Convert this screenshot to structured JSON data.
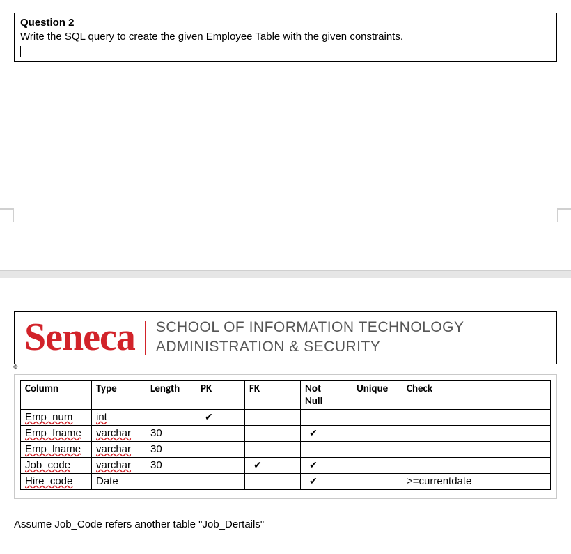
{
  "question": {
    "title": "Question 2",
    "prompt": "Write the SQL query to create the given Employee Table with the given constraints."
  },
  "header": {
    "logo": "Seneca",
    "subtitle_line1": "SCHOOL OF INFORMATION TECHNOLOGY",
    "subtitle_line2": "ADMINISTRATION & SECURITY"
  },
  "schema": {
    "headers": {
      "column": "Column",
      "type": "Type",
      "length": "Length",
      "pk": "PK",
      "fk": "FK",
      "not_null_l1": "Not",
      "not_null_l2": "Null",
      "unique": "Unique",
      "check": "Check"
    },
    "rows": [
      {
        "name_html": "<span class=\"sq\">Emp_num</span>",
        "type_html": "<span class=\"sq\">int</span>",
        "length": "",
        "pk": true,
        "fk": false,
        "nn": false,
        "uq": "",
        "check": ""
      },
      {
        "name_html": "<span class=\"sq\">Emp_fname</span>",
        "type_html": "<span class=\"sq\">varchar</span>",
        "length": "30",
        "pk": false,
        "fk": false,
        "nn": true,
        "uq": "",
        "check": ""
      },
      {
        "name_html": "<span class=\"sq\">Emp_lname</span>",
        "type_html": "<span class=\"sq\">varchar</span>",
        "length": "30",
        "pk": false,
        "fk": false,
        "nn": false,
        "uq": "",
        "check": ""
      },
      {
        "name_html": "<span class=\"sq\">Job_code</span>",
        "type_html": "<span class=\"sq\">varchar</span>",
        "length": "30",
        "pk": false,
        "fk": true,
        "nn": true,
        "uq": "",
        "check": ""
      },
      {
        "name_html": "<span class=\"sq\">Hire_code</span>",
        "type_html": "Date",
        "length": "",
        "pk": false,
        "fk": false,
        "nn": true,
        "uq": "",
        "check": ">=currentdate"
      }
    ]
  },
  "footnote": "Assume Job_Code refers another table \"Job_Dertails\"",
  "icons": {
    "tick": "✔"
  }
}
